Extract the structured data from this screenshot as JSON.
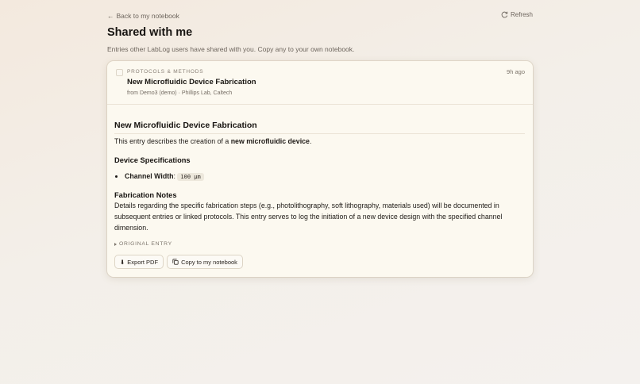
{
  "nav": {
    "back_arrow": "←",
    "back_label": "Back to my notebook",
    "refresh_label": "Refresh",
    "refresh_icon": "refresh-icon"
  },
  "header": {
    "title": "Shared with me",
    "subtitle": "Entries other LabLog users have shared with you. Copy any to your own notebook."
  },
  "entry": {
    "category": "PROTOCOLS & METHODS",
    "time_ago": "9h ago",
    "title": "New Microfluidic Device Fabrication",
    "source": "from Demo3 (demo) · Phillips Lab, Caltech",
    "body": {
      "heading": "New Microfluidic Device Fabrication",
      "intro_before": "This entry describes the creation of a ",
      "intro_bold": "new microfluidic device",
      "intro_after": ".",
      "spec_heading": "Device Specifications",
      "spec_label": "Channel Width",
      "spec_sep": ":",
      "spec_value": "100 µm",
      "notes_heading": "Fabrication Notes",
      "notes_text": "Details regarding the specific fabrication steps (e.g., photolithography, soft lithography, materials used) will be documented in subsequent entries or linked protocols. This entry serves to log the initiation of a new device design with the specified channel dimension."
    },
    "original_entry_label": "ORIGINAL ENTRY",
    "actions": {
      "export_icon": "⬇",
      "export_label": "Export PDF",
      "copy_label": "Copy to my notebook"
    }
  },
  "colors": {
    "card_background": "#fcf9f0",
    "page_background": "#f3efe9",
    "muted_text": "#6c645c"
  }
}
